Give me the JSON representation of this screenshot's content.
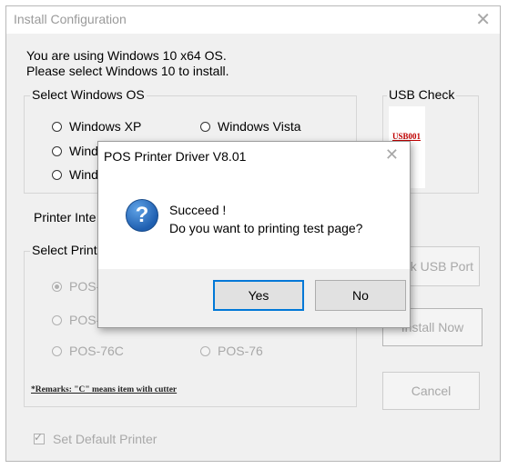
{
  "window": {
    "title": "Install Configuration",
    "close_glyph": "✕"
  },
  "intro": {
    "line1": "You are using Windows 10 x64 OS.",
    "line2": "Please select Windows 10 to install."
  },
  "os_group": {
    "legend": "Select Windows OS",
    "options": [
      "Windows XP",
      "Windows Vista",
      "Wind",
      "Wind"
    ]
  },
  "usb_group": {
    "legend": "USB Check",
    "port": "USB001"
  },
  "printer_interface": {
    "label": "Printer Inte"
  },
  "printer_group": {
    "legend": "Select Printe",
    "options": [
      "POS-",
      "POS-",
      "POS-76C",
      "POS-76"
    ],
    "remark": "*Remarks: \"C\" means item with cutter"
  },
  "buttons": {
    "check_usb": "k USB Port",
    "install": "Install Now",
    "cancel": "Cancel"
  },
  "default_printer": {
    "label": "Set Default Printer",
    "checked": true
  },
  "dialog": {
    "title": "POS Printer Driver V8.01",
    "close_glyph": "✕",
    "icon": "question-icon",
    "icon_glyph": "?",
    "message_line1": "Succeed !",
    "message_line2": "Do you want to printing test page?",
    "yes": "Yes",
    "no": "No"
  },
  "colors": {
    "accent": "#0078d7",
    "question_icon": "#2a6fb8",
    "usb_port_text": "#c00000"
  }
}
